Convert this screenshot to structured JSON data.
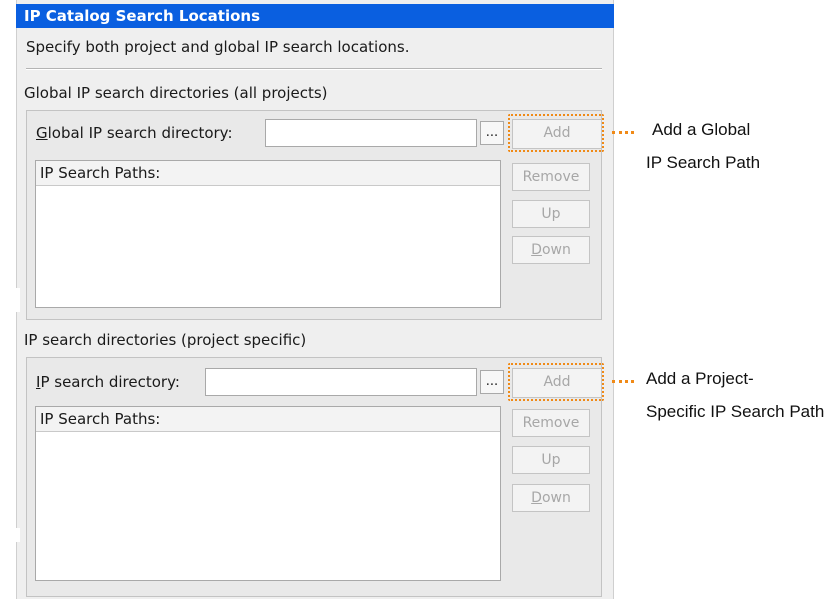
{
  "dialog": {
    "title": "IP Catalog Search Locations",
    "description": "Specify both project and global IP search locations."
  },
  "global_section": {
    "heading": "Global IP search directories (all projects)",
    "dir_label_mnemonic": "G",
    "dir_label_rest": "lobal IP search directory:",
    "dir_value": "",
    "browse_label": "...",
    "list_header": "IP Search Paths:",
    "buttons": {
      "add": "Add",
      "remove": "Remove",
      "up": "Up",
      "down_mnemonic": "D",
      "down_rest": "own"
    }
  },
  "project_section": {
    "heading": "IP search directories (project specific)",
    "dir_label_mnemonic": "I",
    "dir_label_rest": "P search directory:",
    "dir_value": "",
    "browse_label": "...",
    "list_header": "IP Search Paths:",
    "buttons": {
      "add": "Add",
      "remove": "Remove",
      "up": "Up",
      "down_mnemonic": "D",
      "down_rest": "own"
    }
  },
  "callouts": {
    "global_line1": "Add a Global",
    "global_line2": "IP Search Path",
    "project_line1": "Add a Project-",
    "project_line2": "Specific IP Search Path"
  },
  "colors": {
    "title_bar": "#0a5fe0",
    "highlight": "#f08a17",
    "panel": "#efefef"
  }
}
